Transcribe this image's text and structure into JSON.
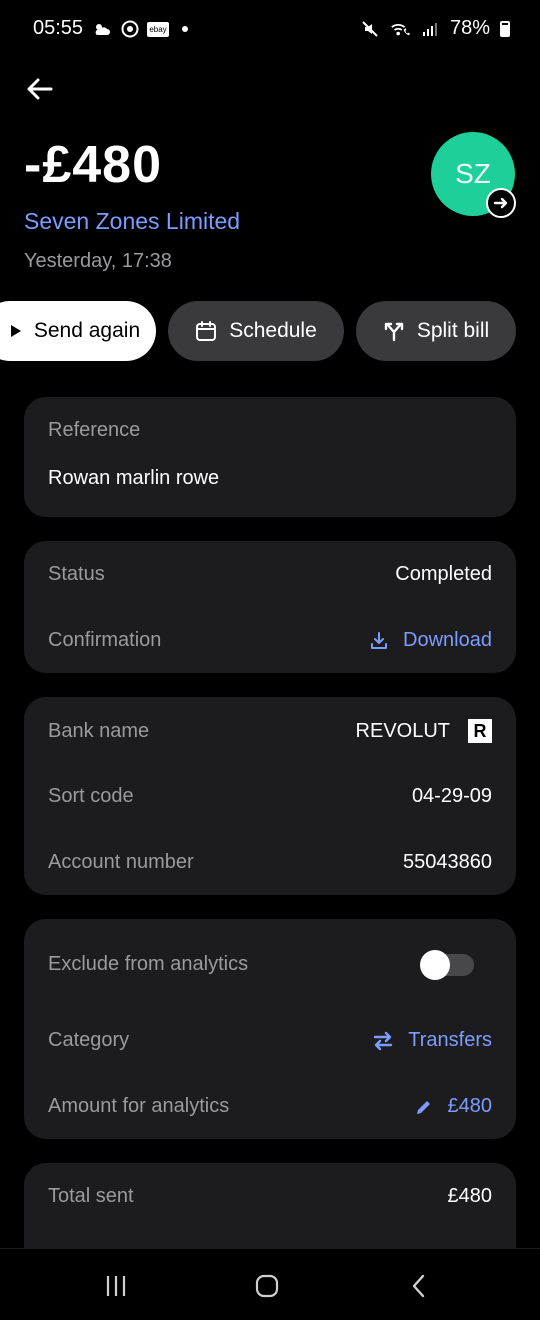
{
  "status_bar": {
    "time": "05:55",
    "battery": "78%",
    "ebay": "ebay",
    "icons": [
      "weather-icon",
      "chrome-icon",
      "ebay-icon",
      "dot-icon",
      "mute-icon",
      "wifi-call-icon",
      "signal-icon",
      "battery-icon"
    ]
  },
  "header": {
    "amount": "-£480",
    "merchant": "Seven Zones Limited",
    "datetime": "Yesterday, 17:38",
    "avatar_initials": "SZ",
    "avatar_color": "#1fcf9a"
  },
  "actions": {
    "send_again": "Send again",
    "schedule": "Schedule",
    "split_bill": "Split bill"
  },
  "reference_card": {
    "label": "Reference",
    "value": "Rowan marlin rowe"
  },
  "status_card": {
    "status_label": "Status",
    "status_value": "Completed",
    "confirmation_label": "Confirmation",
    "download_label": "Download"
  },
  "bank_card": {
    "bank_name_label": "Bank name",
    "bank_name_value": "REVOLUT",
    "bank_logo": "R",
    "sort_code_label": "Sort code",
    "sort_code_value": "04-29-09",
    "account_number_label": "Account number",
    "account_number_value": "55043860"
  },
  "analytics_card": {
    "exclude_label": "Exclude from analytics",
    "exclude_toggle_on": false,
    "category_label": "Category",
    "category_value": "Transfers",
    "amount_label": "Amount for analytics",
    "amount_value": "£480"
  },
  "total_card": {
    "total_label": "Total sent",
    "total_value": "£480"
  },
  "colors": {
    "accent_link": "#7c9cff",
    "card_bg": "#1c1c1e",
    "background": "#000000"
  }
}
